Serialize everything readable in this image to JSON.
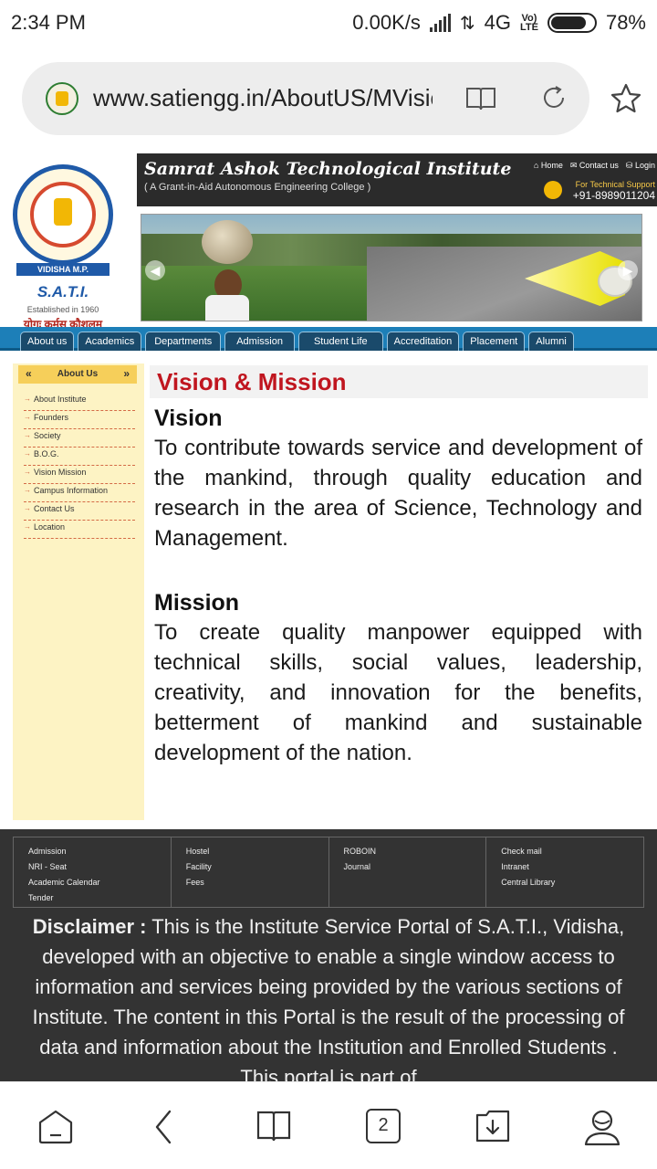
{
  "status": {
    "time": "2:34 PM",
    "speed": "0.00K/s",
    "network": "4G",
    "volte_top": "Vo)",
    "volte_bottom": "LTE",
    "battery": "78%"
  },
  "browser": {
    "url": "www.satiengg.in/AboutUS/MVision.aspx",
    "tab_count": "2"
  },
  "site": {
    "institute_name": "Samrat Ashok Technological Institute",
    "institute_subtitle": "( A Grant-in-Aid Autonomous Engineering College )",
    "top_links": [
      "Home",
      "Contact us",
      "Login"
    ],
    "support_label": "For Technical Support",
    "support_phone": "+91-8989011204",
    "logo": {
      "ribbon": "VIDISHA M.P.",
      "short_name": "S.A.T.I.",
      "established": "Established in 1960",
      "motto": "योगः कर्मसु कौशलम्"
    },
    "nav": [
      "About us",
      "Academics",
      "Departments",
      "Admission",
      "Student Life",
      "Accreditation",
      "Placement",
      "Alumni"
    ],
    "sidebar": {
      "title": "About Us",
      "items": [
        "About Institute",
        "Founders",
        "Society",
        "B.O.G.",
        "Vision Mission",
        "Campus Information",
        "Contact Us",
        "Location"
      ]
    },
    "content": {
      "title": "Vision & Mission",
      "vision_heading": "Vision",
      "vision_text": "To contribute towards service and development of the mankind, through quality education and research in the area of Science, Technology and Management.",
      "mission_heading": "Mission",
      "mission_text": "To create quality manpower equipped with technical skills, social values, leadership, creativity, and innovation for the benefits, betterment of mankind and sustainable development of the nation."
    },
    "footer": {
      "columns": [
        [
          "Admission",
          "NRI - Seat",
          "Academic Calendar",
          "Tender"
        ],
        [
          "Hostel",
          "Facility",
          "Fees"
        ],
        [
          "ROBOIN",
          "Journal"
        ],
        [
          "Check mail",
          "Intranet",
          "Central Library"
        ]
      ],
      "disclaimer_label": "Disclaimer :",
      "disclaimer_text": "This is the Institute Service Portal of S.A.T.I., Vidisha, developed with an objective to enable a single window access to information and services being provided by the various sections of Institute. The content in this Portal is the result of the processing of data and information about the Institution and Enrolled Students . This portal is part of"
    }
  }
}
